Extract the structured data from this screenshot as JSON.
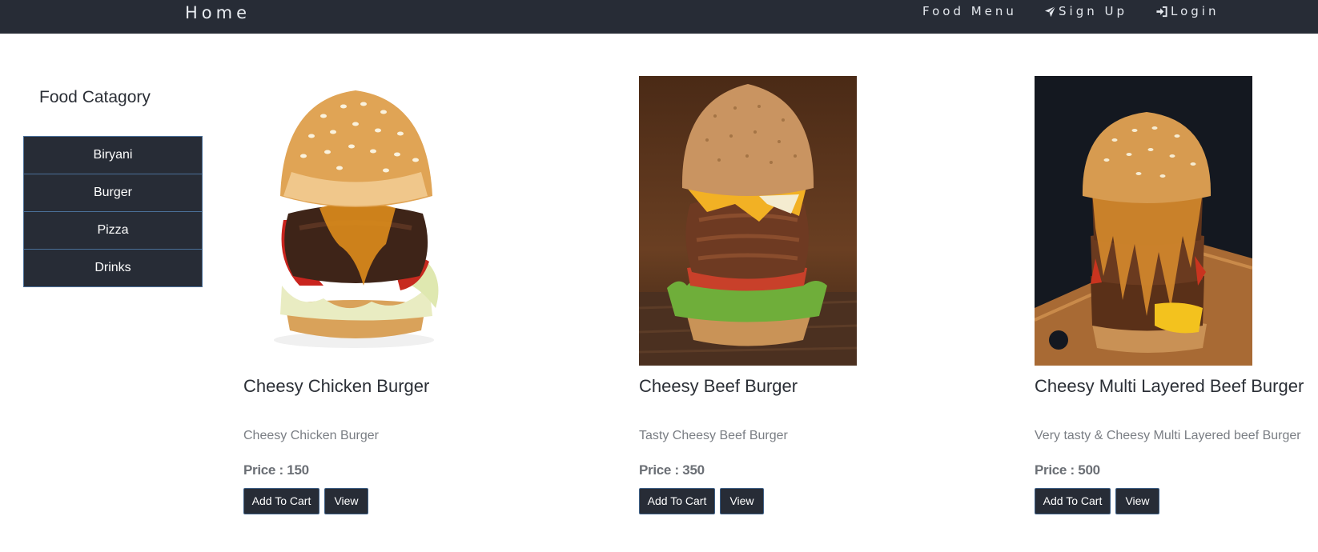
{
  "navbar": {
    "brand": "Home",
    "links": [
      {
        "label": "Food Menu",
        "icon": "none"
      },
      {
        "label": "Sign Up",
        "icon": "paper-plane-icon"
      },
      {
        "label": "Login",
        "icon": "sign-in-icon"
      }
    ]
  },
  "sidebar": {
    "title": "Food Catagory",
    "items": [
      {
        "label": "Biryani"
      },
      {
        "label": "Burger"
      },
      {
        "label": "Pizza"
      },
      {
        "label": "Drinks"
      }
    ]
  },
  "products": [
    {
      "title": "Cheesy Chicken Burger",
      "description": "Cheesy Chicken Burger",
      "price": "Price : 150",
      "add_label": "Add To Cart",
      "view_label": "View",
      "image": "burger-white-background"
    },
    {
      "title": "Cheesy Beef Burger",
      "description": "Tasty Cheesy Beef Burger",
      "price": "Price : 350",
      "add_label": "Add To Cart",
      "view_label": "View",
      "image": "burger-wood-background"
    },
    {
      "title": "Cheesy Multi Layered Beef Burger",
      "description": "Very tasty & Cheesy Multi Layered beef Burger",
      "price": "Price : 500",
      "add_label": "Add To Cart",
      "view_label": "View",
      "image": "stacked-burger-dark-background"
    }
  ],
  "colors": {
    "navbar_bg": "#272c36",
    "button_bg": "#272c36",
    "accent_border": "#4a6f98"
  }
}
